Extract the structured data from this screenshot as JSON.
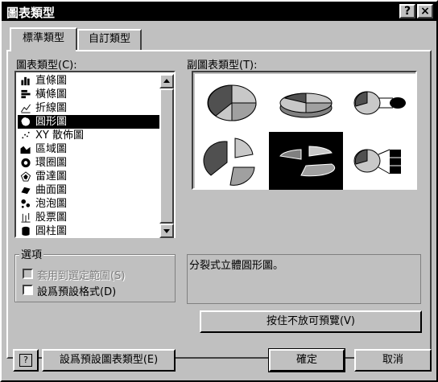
{
  "window": {
    "title": "圖表類型",
    "help_btn": "?",
    "close_btn": "×"
  },
  "tabs": [
    {
      "label": "標準類型"
    },
    {
      "label": "自訂類型"
    }
  ],
  "chart_types": {
    "label": "圖表類型(C):",
    "items": [
      {
        "label": "直條圖",
        "icon": "column-chart-icon"
      },
      {
        "label": "橫條圖",
        "icon": "bar-chart-icon"
      },
      {
        "label": "折線圖",
        "icon": "line-chart-icon"
      },
      {
        "label": "圓形圖",
        "icon": "pie-chart-icon",
        "selected": true
      },
      {
        "label": "XY 散佈圖",
        "icon": "scatter-chart-icon"
      },
      {
        "label": "區域圖",
        "icon": "area-chart-icon"
      },
      {
        "label": "環圈圖",
        "icon": "doughnut-chart-icon"
      },
      {
        "label": "雷達圖",
        "icon": "radar-chart-icon"
      },
      {
        "label": "曲面圖",
        "icon": "surface-chart-icon"
      },
      {
        "label": "泡泡圖",
        "icon": "bubble-chart-icon"
      },
      {
        "label": "股票圖",
        "icon": "stock-chart-icon"
      },
      {
        "label": "圓柱圖",
        "icon": "cylinder-chart-icon"
      }
    ]
  },
  "subtypes": {
    "label": "副圖表類型(T):",
    "selected_index": 4
  },
  "options": {
    "legend": "選項",
    "apply_selection": "套用到選定範圍(S)",
    "set_default_format": "設爲預設格式(D)"
  },
  "description": "分裂式立體圓形圖。",
  "preview_button": "按住不放可預覽(V)",
  "footer": {
    "help_icon": "?",
    "set_default_button": "設爲預設圖表類型(E)",
    "ok_button": "確定",
    "cancel_button": "取消"
  }
}
